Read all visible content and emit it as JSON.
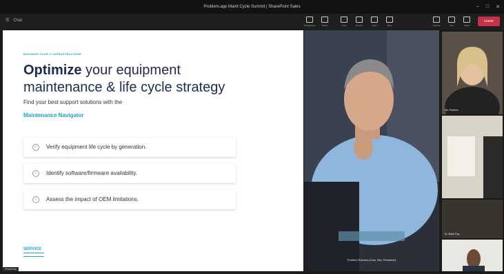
{
  "window": {
    "title": "Problem.app Maint Cycle Summit | SharePoint Sales"
  },
  "toolbar": {
    "left_label": "Chat",
    "buttons": [
      {
        "name": "people-button",
        "label": "Participants"
      },
      {
        "name": "react-button",
        "label": "React"
      },
      {
        "name": "view-button",
        "label": "View"
      },
      {
        "name": "rooms-button",
        "label": "Rooms"
      },
      {
        "name": "apps-button",
        "label": "Apps"
      },
      {
        "name": "more-button",
        "label": "More"
      },
      {
        "name": "camera-button",
        "label": "Camera"
      },
      {
        "name": "mic-button",
        "label": "Mic"
      },
      {
        "name": "share-button",
        "label": "Share"
      }
    ],
    "leave_label": "Leave"
  },
  "slide": {
    "eyebrow": "MAXIMIZE YOUR IT INFRASTRUCTURE",
    "headline_bold": "Optimize",
    "headline_rest": " your equipment maintenance & life cycle strategy",
    "subtitle": "Find your best support solutions with the",
    "subtitle_link": "Maintenance Navigator",
    "items": [
      "Verify equipment life cycle by generation.",
      "Identify software/firmware availability.",
      "Assess the impact of OEM limitations."
    ],
    "logo_text": "SERVICE"
  },
  "presenter_tag": "Presenting",
  "main_video": {
    "speaker_name": "Problem Express (Cam, Mic, Presenter)"
  },
  "tiles": [
    {
      "name": "Ms. Problem"
    },
    {
      "name": ""
    },
    {
      "name": "Dr. Maint Guy"
    },
    {
      "name": ""
    }
  ],
  "colors": {
    "accent": "#1aa0c9",
    "headline": "#1d2b4f",
    "leave": "#c4314b"
  }
}
